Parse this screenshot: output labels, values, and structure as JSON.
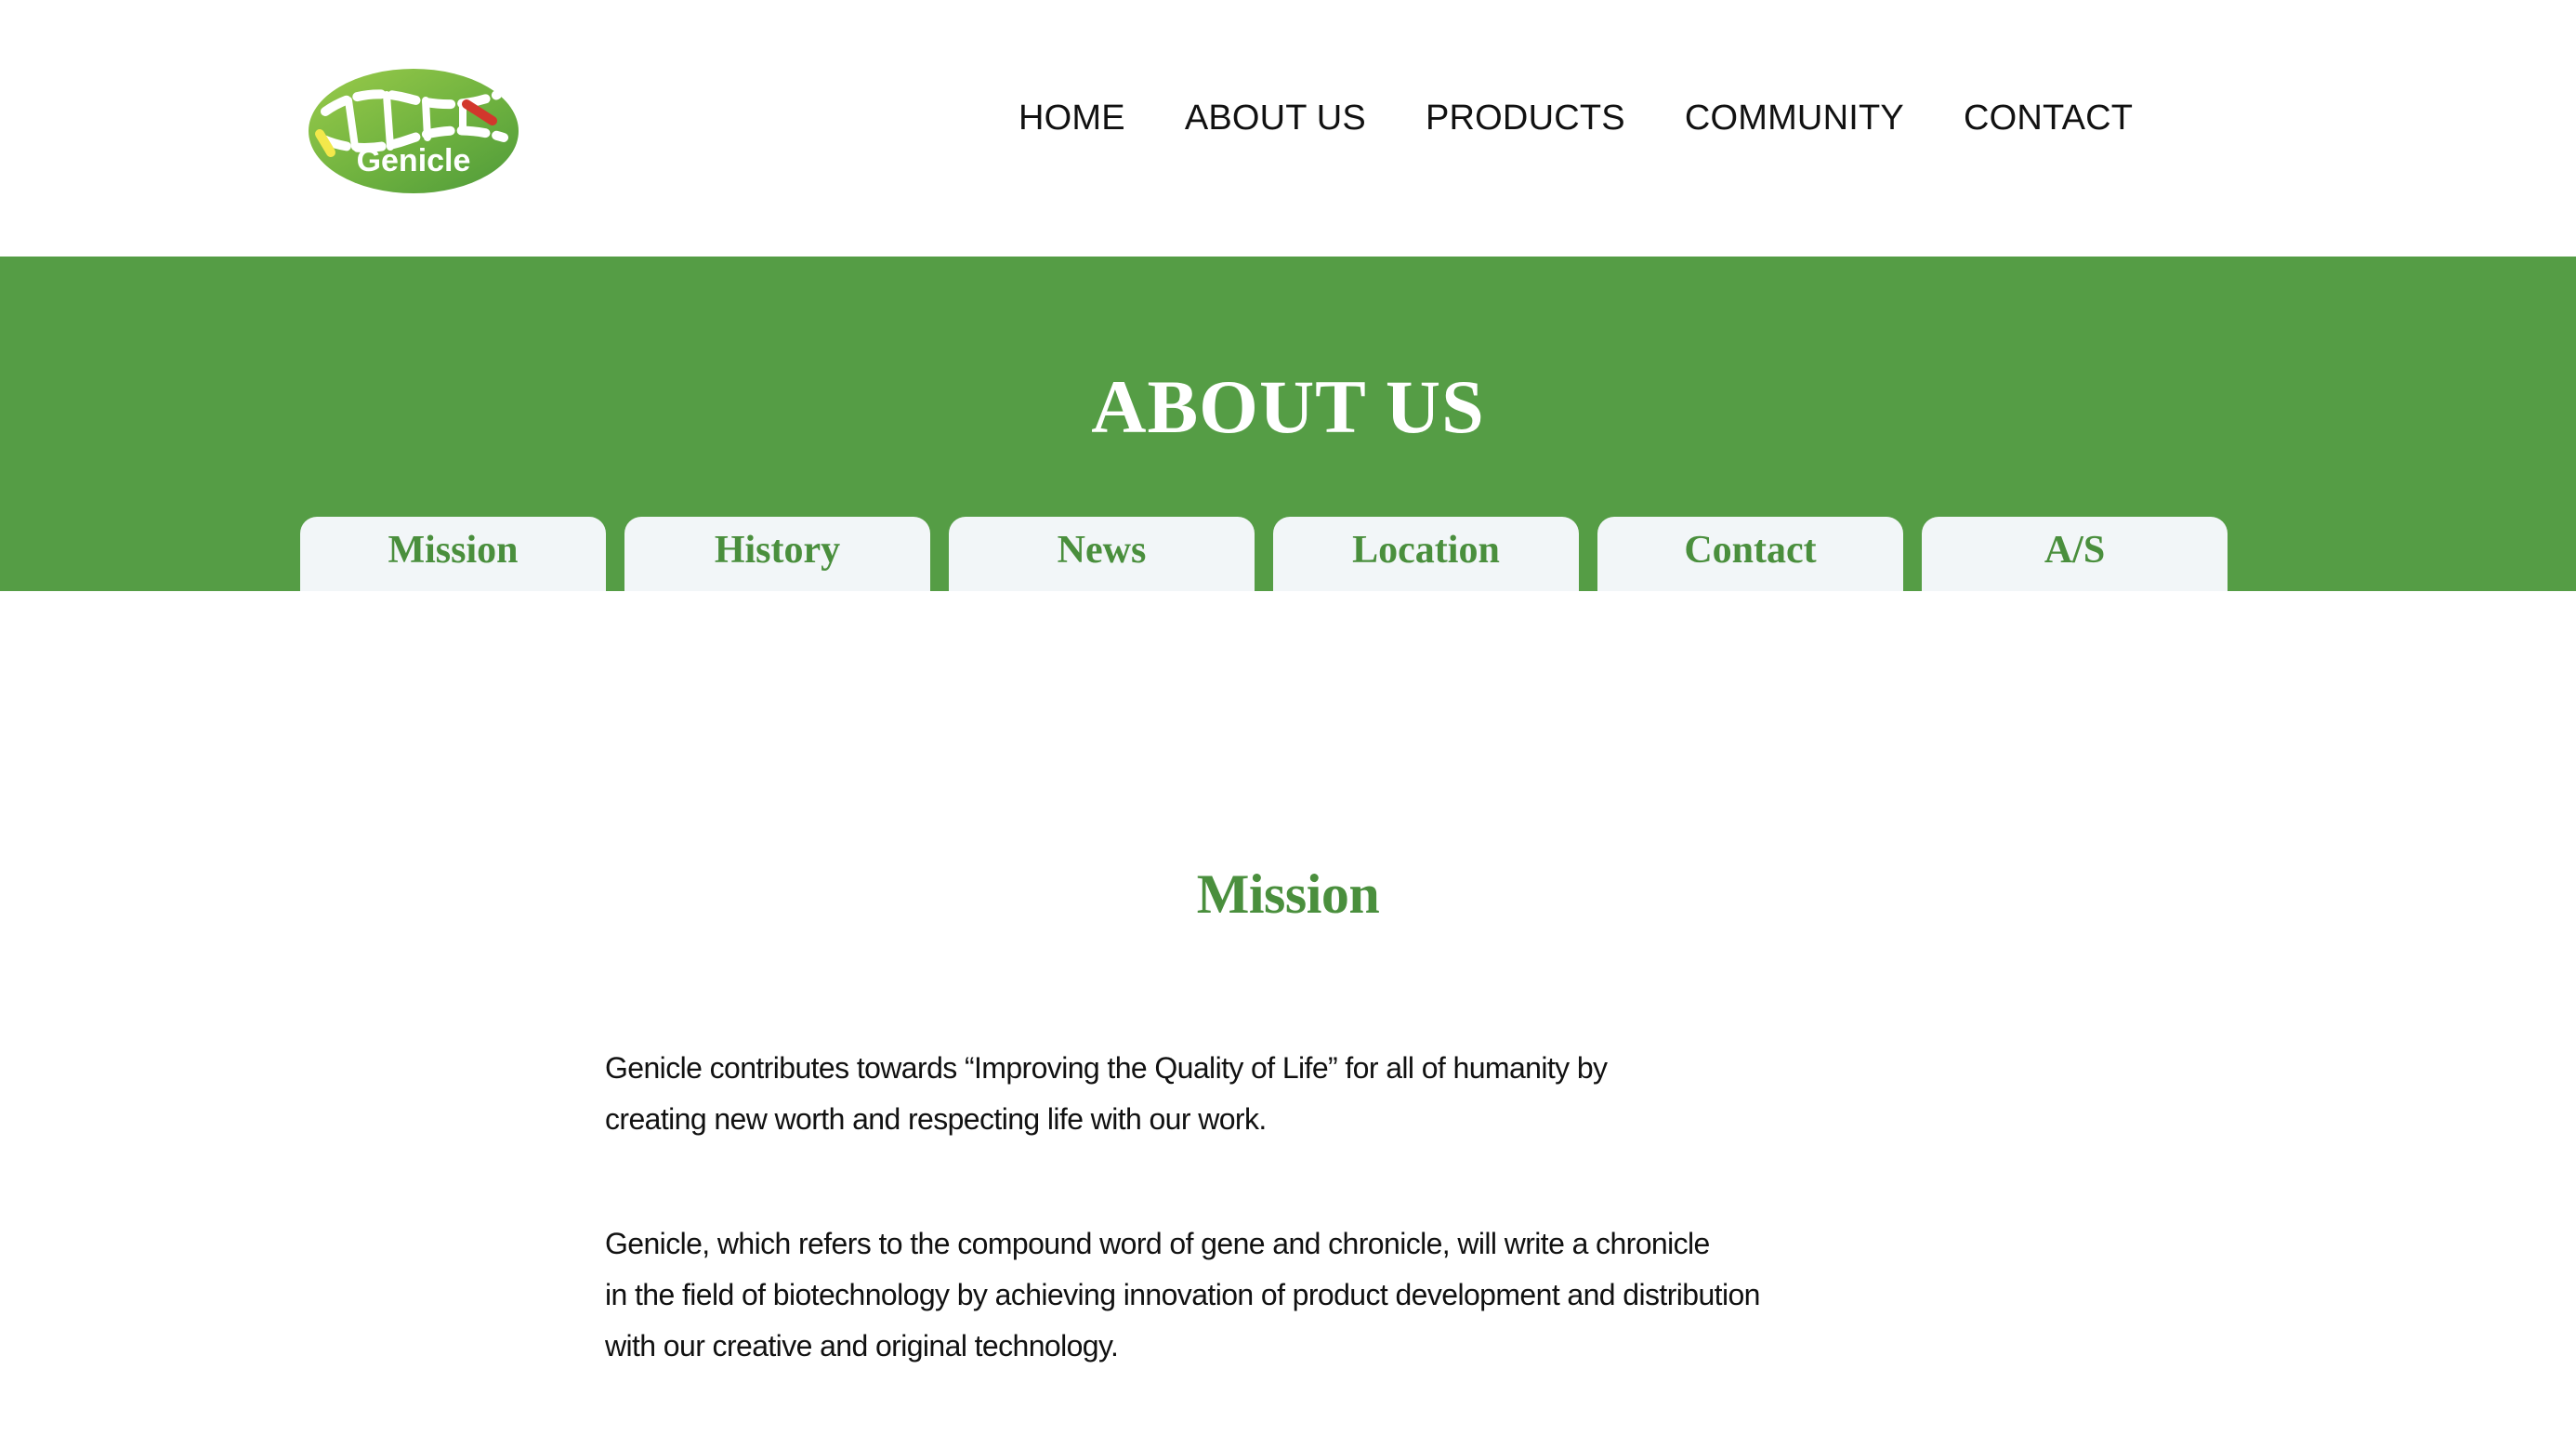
{
  "header": {
    "logo_text": "Genicle",
    "nav": [
      "HOME",
      "ABOUT US",
      "PRODUCTS",
      "COMMUNITY",
      "CONTACT"
    ]
  },
  "banner": {
    "title": "ABOUT US",
    "tabs": [
      "Mission",
      "History",
      "News",
      "Location",
      "Contact",
      "A/S"
    ]
  },
  "content": {
    "section_title": "Mission",
    "paragraph1": [
      "Genicle contributes towards “Improving the Quality of Life” for all of humanity by",
      "creating new worth and respecting life with our work."
    ],
    "paragraph2": [
      "Genicle, which refers to the compound word of gene and chronicle, will write a chronicle",
      "in the field of biotechnology by achieving innovation of product development and distribution",
      "with our creative and original technology."
    ]
  },
  "colors": {
    "brand_green": "#559d45",
    "tab_text_green": "#4a8f3d",
    "tab_bg": "#f2f6f8"
  }
}
